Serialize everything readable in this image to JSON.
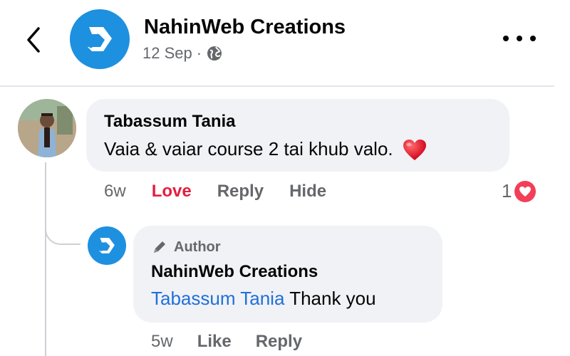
{
  "header": {
    "page_name": "NahinWeb Creations",
    "date": "12 Sep",
    "separator": "·",
    "icons": {
      "back": "chevron-left-icon",
      "privacy": "globe-icon",
      "more": "more-horizontal-icon"
    }
  },
  "comments": [
    {
      "author": "Tabassum Tania",
      "text": "Vaia & vaiar course 2 tai khub valo.",
      "emoji": "red-heart-emoji",
      "time": "6w",
      "reacted_label": "Love",
      "reply_label": "Reply",
      "hide_label": "Hide",
      "reaction_count": "1",
      "reaction_type": "love",
      "reply": {
        "badge": "Author",
        "author": "NahinWeb Creations",
        "mention": "Tabassum Tania",
        "text": "Thank you",
        "time": "5w",
        "like_label": "Like",
        "reply_label": "Reply"
      }
    }
  ],
  "colors": {
    "brand_blue": "#1e90e0",
    "love_red": "#e41e3f",
    "mention_blue": "#216fdb",
    "bubble_bg": "#f0f2f5",
    "secondary_text": "#65676b"
  }
}
